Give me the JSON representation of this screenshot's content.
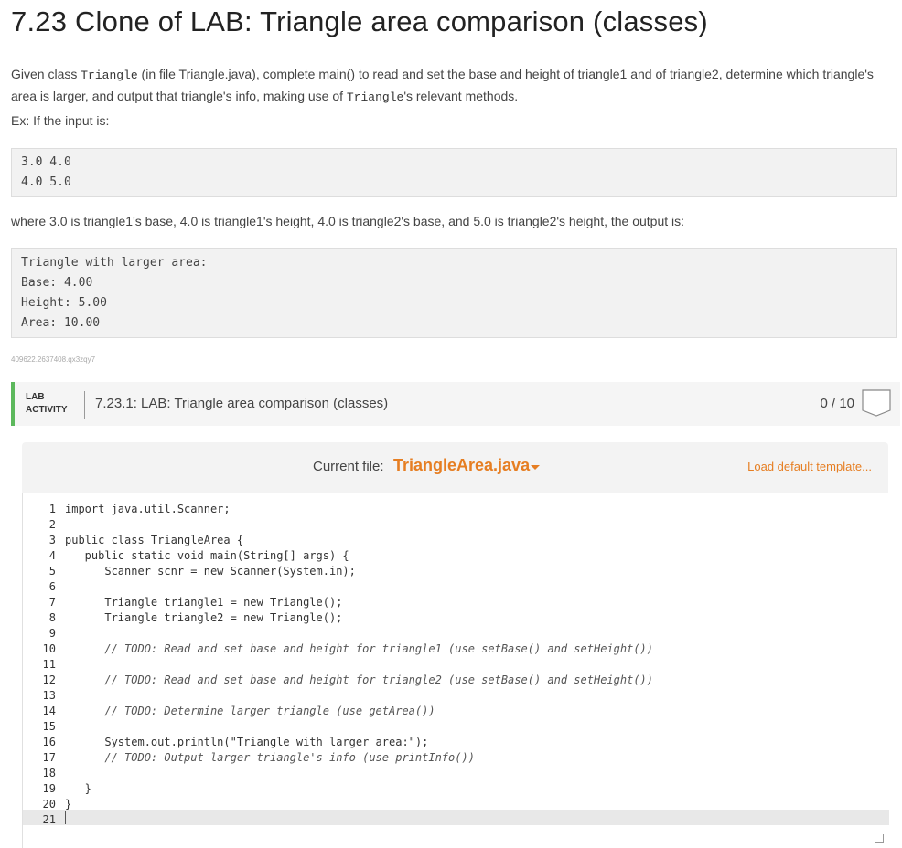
{
  "page": {
    "title": "7.23 Clone of LAB: Triangle area comparison (classes)",
    "desc_1": "Given class ",
    "desc_code_1": "Triangle",
    "desc_2": " (in file Triangle.java), complete main() to read and set the base and height of triangle1 and of triangle2, determine which triangle's area is larger, and output that triangle's info, making use of ",
    "desc_code_2": "Triangle",
    "desc_3": "'s relevant methods.",
    "ex_label": "Ex: If the input is:",
    "input_lines": [
      "3.0 4.0",
      "4.0 5.0"
    ],
    "where_text": "where 3.0 is triangle1's base, 4.0 is triangle1's height, 4.0 is triangle2's base, and 5.0 is triangle2's height, the output is:",
    "output_lines": [
      "Triangle with larger area:",
      "Base: 4.00",
      "Height: 5.00",
      "Area: 10.00"
    ],
    "problem_id": "409622.2637408.qx3zqy7"
  },
  "lab": {
    "tag_line1": "LAB",
    "tag_line2": "ACTIVITY",
    "title": "7.23.1: LAB: Triangle area comparison (classes)",
    "score": "0 / 10",
    "accent_color": "#5cb85c"
  },
  "editor": {
    "current_file_label": "Current file:",
    "file_name": "TriangleArea.java",
    "load_template": "Load default template...",
    "accent_color": "#e67e22",
    "line_numbers": [
      "1",
      "2",
      "3",
      "4",
      "5",
      "6",
      "7",
      "8",
      "9",
      "10",
      "11",
      "12",
      "13",
      "14",
      "15",
      "16",
      "17",
      "18",
      "19",
      "20",
      "21"
    ],
    "lines": [
      "import java.util.Scanner;",
      "",
      "public class TriangleArea {",
      "   public static void main(String[] args) {",
      "      Scanner scnr = new Scanner(System.in);",
      "",
      "      Triangle triangle1 = new Triangle();",
      "      Triangle triangle2 = new Triangle();",
      "",
      "      // TODO: Read and set base and height for triangle1 (use setBase() and setHeight())",
      "",
      "      // TODO: Read and set base and height for triangle2 (use setBase() and setHeight())",
      "",
      "      // TODO: Determine larger triangle (use getArea())",
      "",
      "      System.out.println(\"Triangle with larger area:\");",
      "      // TODO: Output larger triangle's info (use printInfo())",
      "",
      "   }",
      "}",
      ""
    ]
  }
}
